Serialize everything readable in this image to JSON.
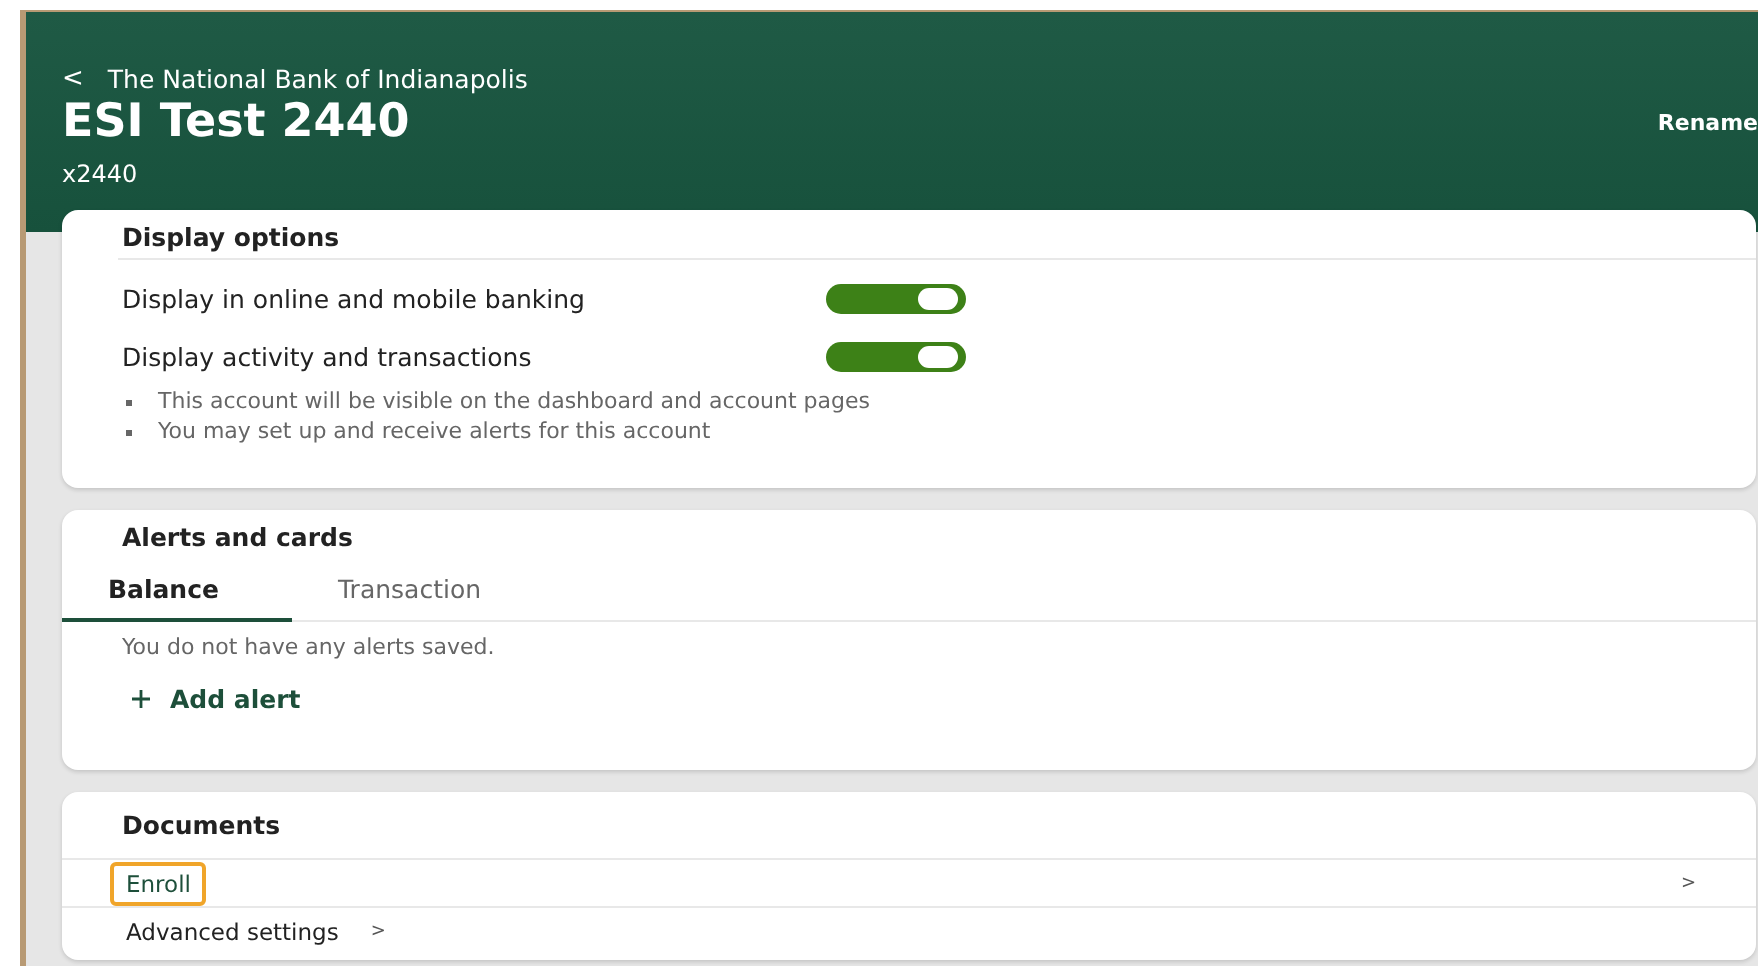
{
  "header": {
    "back": "<",
    "bank": "The National Bank of Indianapolis",
    "title": "ESI Test 2440",
    "account": "x2440",
    "rename": "Rename"
  },
  "display_options": {
    "title": "Display options",
    "toggles": [
      {
        "label": "Display in online and mobile banking",
        "on": true
      },
      {
        "label": "Display activity and transactions",
        "on": true
      }
    ],
    "notes": [
      "This account will be visible on the dashboard and account pages",
      "You may set up and receive alerts for this account"
    ]
  },
  "alerts": {
    "title": "Alerts and cards",
    "tabs": [
      {
        "label": "Balance",
        "selected": true
      },
      {
        "label": "Transaction",
        "selected": false
      }
    ],
    "empty": "You do not have any alerts saved.",
    "add": "Add alert"
  },
  "documents": {
    "title": "Documents",
    "rows": [
      {
        "label": "Enroll",
        "chevron": ">",
        "focused": true
      },
      {
        "label": "Advanced settings",
        "chevron": ">",
        "focused": false
      }
    ]
  }
}
